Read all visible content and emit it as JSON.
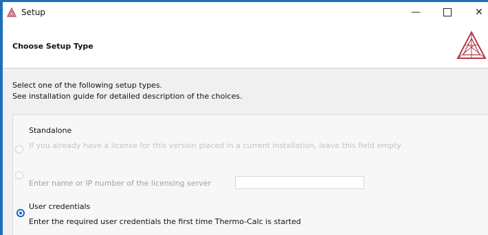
{
  "window": {
    "title": "Setup",
    "minimize_symbol": "—",
    "close_symbol": "✕"
  },
  "header": {
    "title": "Choose Setup Type"
  },
  "intro": {
    "line1": "Select one of the following setup types.",
    "line2": "See installation guide for detailed description of the choices."
  },
  "options": {
    "standalone": {
      "label": "Standalone",
      "description": "If you already have a license for this version placed in a current installation, leave this field empty",
      "selected": false
    },
    "network": {
      "description": "Enter name or IP number of the licensing server",
      "server_value": "",
      "selected": false
    },
    "user_credentials": {
      "label": "User credentials",
      "description": "Enter the required user credentials the first time Thermo-Calc is started",
      "selected": true
    }
  },
  "colors": {
    "accent": "#1565c0",
    "logo": "#b03a48",
    "frame": "#1f6fb8"
  },
  "icons": {
    "app": "thermo-calc-logo-icon",
    "header": "thermo-calc-logo-icon"
  }
}
